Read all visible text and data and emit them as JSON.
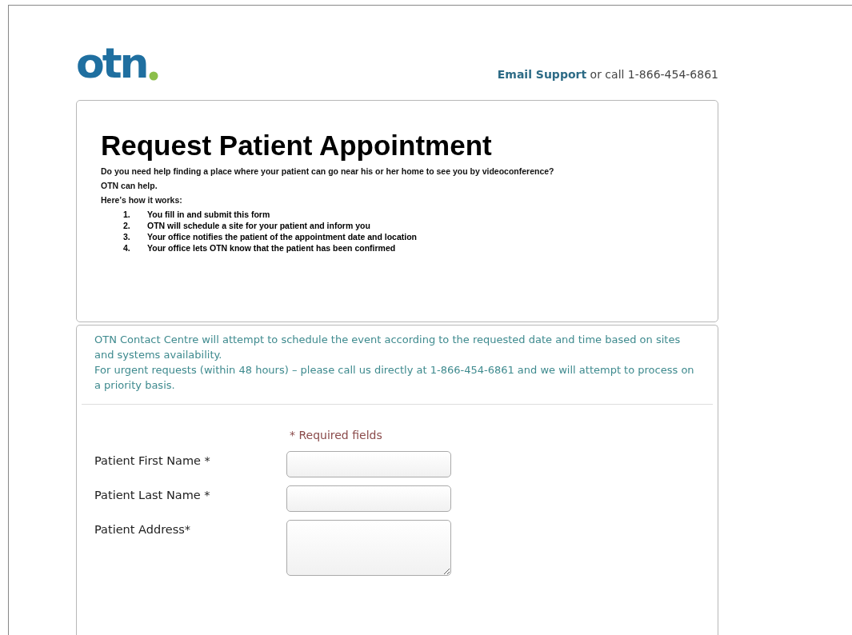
{
  "header": {
    "logo": "otn",
    "support_link": "Email Support",
    "support_text": "or call 1-866-454-6861"
  },
  "intro": {
    "title": "Request Patient Appointment",
    "paragraphs": [
      "Do you need help finding a place where your patient can go near his or her home to see you by videoconference?",
      "OTN can help.",
      "Here’s how it works:"
    ],
    "steps": [
      {
        "number": "1.",
        "text": "You fill in and submit this form"
      },
      {
        "number": "2.",
        "text": "OTN will schedule a site for your patient and inform you"
      },
      {
        "number": "3.",
        "text": "Your office notifies the patient of the appointment date and location"
      },
      {
        "number": "4.",
        "text": "Your office lets OTN know that the patient has been confirmed"
      }
    ]
  },
  "notice": [
    "OTN Contact Centre will attempt to schedule the event according to the requested date and time based on sites and systems availability.",
    "For urgent requests (within 48 hours) – please call us directly at 1-866-454-6861 and we will attempt to process on a priority basis."
  ],
  "form": {
    "required_note": "* Required fields",
    "fields": [
      {
        "label": "Patient First Name *",
        "kind": "text"
      },
      {
        "label": "Patient Last Name *",
        "kind": "text"
      },
      {
        "label": "Patient Address*",
        "kind": "textarea"
      }
    ]
  }
}
